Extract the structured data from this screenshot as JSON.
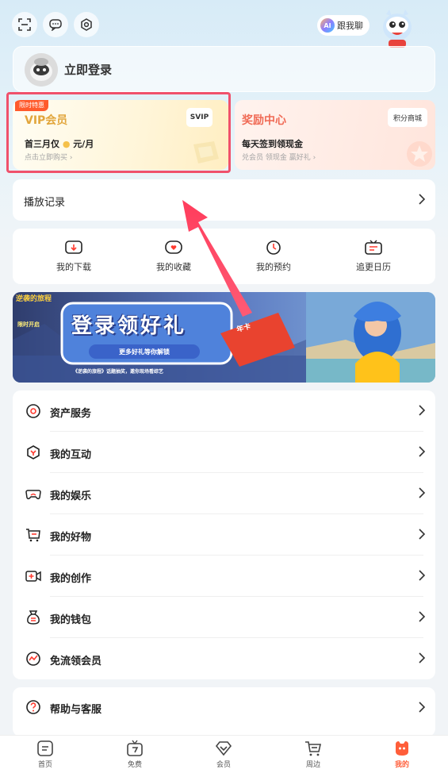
{
  "topbar": {
    "icons": [
      "scan-icon",
      "message-icon",
      "settings-icon"
    ],
    "ai_badge": "AI",
    "ai_label": "跟我聊"
  },
  "login": {
    "label": "立即登录"
  },
  "vip": {
    "tag": "限时特惠",
    "title": "VIP会员",
    "badge": "SVIP",
    "desc_prefix": "首三月仅",
    "desc_suffix": "元/月",
    "sub": "点击立即购买",
    "title_color": "#e2a63c"
  },
  "reward": {
    "title": "奖励中心",
    "badge": "积分商城",
    "desc": "每天签到领现金",
    "sub": "兑会员 领现金 赢好礼",
    "title_color": "#f06a55"
  },
  "history": {
    "label": "播放记录"
  },
  "shortcuts": [
    {
      "label": "我的下载",
      "icon": "download-icon"
    },
    {
      "label": "我的收藏",
      "icon": "heart-icon"
    },
    {
      "label": "我的预约",
      "icon": "clock-icon"
    },
    {
      "label": "追更日历",
      "icon": "tv-calendar-icon"
    }
  ],
  "banner": {
    "logo": "逆袭的旅程",
    "side": "限时开启",
    "title": "登录领好礼",
    "button": "更多好礼等你解锁",
    "note": "《逆袭的旅程》话题抽奖，邀你现场看综艺",
    "pet_text": "年卡"
  },
  "menu": [
    {
      "label": "资产服务",
      "icon": "asset-icon"
    },
    {
      "label": "我的互动",
      "icon": "interaction-icon"
    },
    {
      "label": "我的娱乐",
      "icon": "gamepad-icon"
    },
    {
      "label": "我的好物",
      "icon": "cart-icon"
    },
    {
      "label": "我的创作",
      "icon": "video-camera-icon"
    },
    {
      "label": "我的钱包",
      "icon": "wallet-icon"
    },
    {
      "label": "免流领会员",
      "icon": "data-free-icon"
    }
  ],
  "help": {
    "label": "帮助与客服"
  },
  "tabs": [
    {
      "label": "首页",
      "icon": "home-icon"
    },
    {
      "label": "免费",
      "icon": "free-tv-icon"
    },
    {
      "label": "会员",
      "icon": "vip-diamond-icon"
    },
    {
      "label": "周边",
      "icon": "shopping-cart-icon"
    },
    {
      "label": "我的",
      "icon": "profile-icon",
      "active": true
    }
  ],
  "accent_color": "#ff5e3a",
  "highlight_color": "#f0516b"
}
